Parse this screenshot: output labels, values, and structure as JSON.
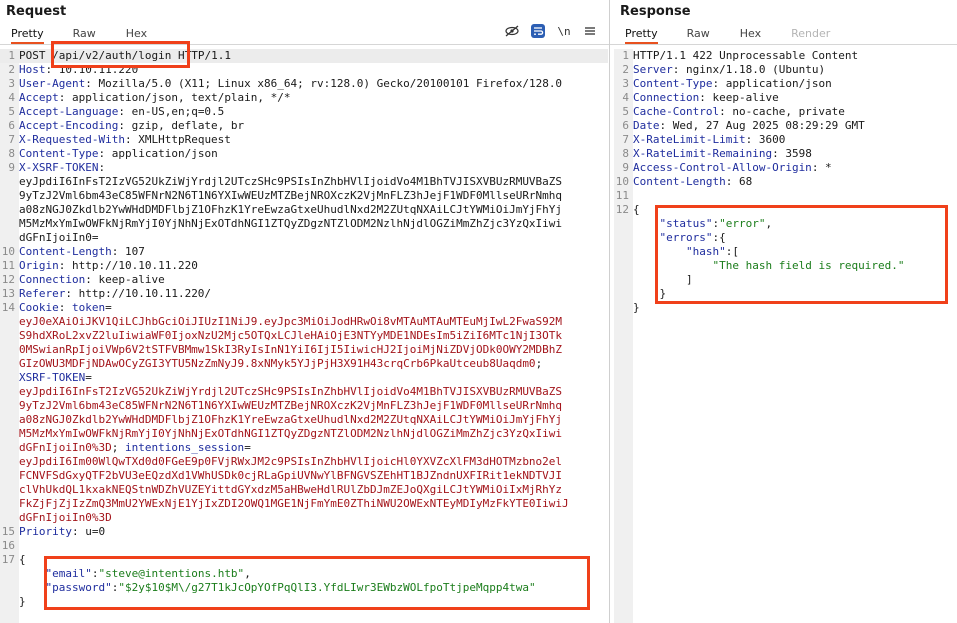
{
  "request": {
    "title": "Request",
    "tabs": [
      "Pretty",
      "Raw",
      "Hex"
    ],
    "newline_toggle": "\\n",
    "lines": [
      {
        "n": "1",
        "parts": [
          [
            "POST ",
            "lt"
          ],
          [
            "/api/v2/auth/login",
            "lt"
          ],
          [
            " HTTP/1.1",
            "lt"
          ]
        ]
      },
      {
        "n": "2",
        "parts": [
          [
            "Host",
            "k"
          ],
          [
            ": 10.10.11.220",
            "v"
          ]
        ]
      },
      {
        "n": "3",
        "parts": [
          [
            "User-Agent",
            "k"
          ],
          [
            ": Mozilla/5.0 (X11; Linux x86_64; rv:128.0) Gecko/20100101 Firefox/128.0",
            "v"
          ]
        ]
      },
      {
        "n": "4",
        "parts": [
          [
            "Accept",
            "k"
          ],
          [
            ": application/json, text/plain, */*",
            "v"
          ]
        ]
      },
      {
        "n": "5",
        "parts": [
          [
            "Accept-Language",
            "k"
          ],
          [
            ": en-US,en;q=0.5",
            "v"
          ]
        ]
      },
      {
        "n": "6",
        "parts": [
          [
            "Accept-Encoding",
            "k"
          ],
          [
            ": gzip, deflate, br",
            "v"
          ]
        ]
      },
      {
        "n": "7",
        "parts": [
          [
            "X-Requested-With",
            "k"
          ],
          [
            ": XMLHttpRequest",
            "v"
          ]
        ]
      },
      {
        "n": "8",
        "parts": [
          [
            "Content-Type",
            "k"
          ],
          [
            ": application/json",
            "v"
          ]
        ]
      },
      {
        "n": "9",
        "parts": [
          [
            "X-XSRF-TOKEN",
            "k"
          ],
          [
            ":",
            "v"
          ]
        ]
      },
      {
        "n": "",
        "parts": [
          [
            "eyJpdiI6InFsT2IzVG52UkZiWjYrdjl2UTczSHc9PSIsInZhbHVlIjoidVo4M1BhTVJISXVBUzRMUVBaZS",
            "v"
          ]
        ]
      },
      {
        "n": "",
        "parts": [
          [
            "9yTzJ2Vml6bm43eC85WFNrN2N6T1N6YXIwWEUzMTZBejNROXczK2VjMnFLZ3hJejF1WDF0MllseURrNmhq",
            "v"
          ]
        ]
      },
      {
        "n": "",
        "parts": [
          [
            "a08zNGJ0Zkdlb2YwWHdDMDFlbjZ1OFhzK1YreEwzaGtxeUhudlNxd2M2ZUtqNXAiLCJtYWMiOiJmYjFhYj",
            "v"
          ]
        ]
      },
      {
        "n": "",
        "parts": [
          [
            "M5MzMxYmIwOWFkNjRmYjI0YjNhNjExOTdhNGI1ZTQyZDgzNTZlODM2NzlhNjdlOGZiMmZhZjc3YzQxIiwi",
            "v"
          ]
        ]
      },
      {
        "n": "",
        "parts": [
          [
            "dGFnIjoiIn0=",
            "v"
          ]
        ]
      },
      {
        "n": "10",
        "parts": [
          [
            "Content-Length",
            "k"
          ],
          [
            ": 107",
            "v"
          ]
        ]
      },
      {
        "n": "11",
        "parts": [
          [
            "Origin",
            "k"
          ],
          [
            ": http://10.10.11.220",
            "v"
          ]
        ]
      },
      {
        "n": "12",
        "parts": [
          [
            "Connection",
            "k"
          ],
          [
            ": keep-alive",
            "v"
          ]
        ]
      },
      {
        "n": "13",
        "parts": [
          [
            "Referer",
            "k"
          ],
          [
            ": http://10.10.11.220/",
            "v"
          ]
        ]
      },
      {
        "n": "14",
        "parts": [
          [
            "Cookie",
            "k"
          ],
          [
            ": ",
            "v"
          ],
          [
            "token",
            "k"
          ],
          [
            "=",
            "v"
          ]
        ]
      },
      {
        "n": "",
        "parts": [
          [
            "eyJ0eXAiOiJKV1QiLCJhbGciOiJIUzI1NiJ9.eyJpc3MiOiJodHRwOi8vMTAuMTAuMTEuMjIwL2FwaS92M",
            "red"
          ]
        ]
      },
      {
        "n": "",
        "parts": [
          [
            "S9hdXRoL2xvZ2luIiwiaWF0IjoxNzU2Mjc5OTQxLCJleHAiOjE3NTYyMDE1NDEsIm5iZiI6MTc1NjI3OTk",
            "red"
          ]
        ]
      },
      {
        "n": "",
        "parts": [
          [
            "0MSwianRpIjoiVWp6V2tSTFVBMmw1SkI3RyIsInN1YiI6IjI5IiwicHJ2IjoiMjNiZDVjODk0OWY2MDBhZ",
            "red"
          ]
        ]
      },
      {
        "n": "",
        "parts": [
          [
            "GIzOWU3MDFjNDAwOCyZGI3YTU5NzZmNyJ9.8xNMyk5YJjPjH3X91H43crqCrb6PkaUtceub8Uaqdm0",
            "red"
          ],
          [
            ";",
            "v"
          ]
        ]
      },
      {
        "n": "",
        "parts": [
          [
            "XSRF-TOKEN",
            "k"
          ],
          [
            "=",
            "v"
          ]
        ]
      },
      {
        "n": "",
        "parts": [
          [
            "eyJpdiI6InFsT2IzVG52UkZiWjYrdjl2UTczSHc9PSIsInZhbHVlIjoidVo4M1BhTVJISXVBUzRMUVBaZS",
            "red"
          ]
        ]
      },
      {
        "n": "",
        "parts": [
          [
            "9yTzJ2Vml6bm43eC85WFNrN2N6T1N6YXIwWEUzMTZBejNROXczK2VjMnFLZ3hJejF1WDF0MllseURrNmhq",
            "red"
          ]
        ]
      },
      {
        "n": "",
        "parts": [
          [
            "a08zNGJ0Zkdlb2YwWHdDMDFlbjZ1OFhzK1YreEwzaGtxeUhudlNxd2M2ZUtqNXAiLCJtYWMiOiJmYjFhYj",
            "red"
          ]
        ]
      },
      {
        "n": "",
        "parts": [
          [
            "M5MzMxYmIwOWFkNjRmYjI0YjNhNjExOTdhNGI1ZTQyZDgzNTZlODM2NzlhNjdlOGZiMmZhZjc3YzQxIiwi",
            "red"
          ]
        ]
      },
      {
        "n": "",
        "parts": [
          [
            "dGFnIjoiIn0%3D",
            "red"
          ],
          [
            "; ",
            "v"
          ],
          [
            "intentions_session",
            "k"
          ],
          [
            "=",
            "v"
          ]
        ]
      },
      {
        "n": "",
        "parts": [
          [
            "eyJpdiI6Im00WlQwTXd0d0FGeE9p0FVjRWxJM2c9PSIsInZhbHVlIjoicHl0YXVZcXlFM3dHOTMzbno2el",
            "red"
          ]
        ]
      },
      {
        "n": "",
        "parts": [
          [
            "FCNVFSdGxyQTF2bVU3eEQzdXd1VWhUSDk0cjRLaGpiUVNwYlBFNGVSZEhHT1BJZndnUXFIRit1ekNDTVJI",
            "red"
          ]
        ]
      },
      {
        "n": "",
        "parts": [
          [
            "clVhUkdQL1kxakNEQStnWDZhVUZEYittdGYxdzM5aHBweHdlRUlZbDJmZEJoQXgiLCJtYWMiOiIxMjRhYz",
            "red"
          ]
        ]
      },
      {
        "n": "",
        "parts": [
          [
            "FkZjFjZjIzZmQ3MmU2YWExNjE1YjIxZDI2OWQ1MGE1NjFmYmE0ZThiNWU2OWExNTEyMDIyMzFkYTE0IiwiJ",
            "red"
          ]
        ]
      },
      {
        "n": "",
        "parts": [
          [
            "dGFnIjoiIn0%3D",
            "red"
          ]
        ]
      },
      {
        "n": "15",
        "parts": [
          [
            "Priority",
            "k"
          ],
          [
            ": u=0",
            "v"
          ]
        ]
      },
      {
        "n": "16",
        "parts": [
          [
            "",
            "v"
          ]
        ]
      },
      {
        "n": "17",
        "parts": [
          [
            "{",
            "v"
          ]
        ]
      },
      {
        "n": "",
        "parts": [
          [
            "    ",
            "v"
          ],
          [
            "\"email\"",
            "jk"
          ],
          [
            ":",
            "v"
          ],
          [
            "\"steve@intentions.htb\"",
            "js"
          ],
          [
            ",",
            "v"
          ]
        ]
      },
      {
        "n": "",
        "parts": [
          [
            "    ",
            "v"
          ],
          [
            "\"password\"",
            "jk"
          ],
          [
            ":",
            "v"
          ],
          [
            "\"$2y$10$M\\/g27T1kJcOpYOfPqQlI3.YfdLIwr3EWbzWOLfpoTtjpeMqpp4twa\"",
            "js"
          ]
        ]
      },
      {
        "n": "",
        "parts": [
          [
            "}",
            "v"
          ]
        ]
      }
    ]
  },
  "response": {
    "title": "Response",
    "tabs": [
      "Pretty",
      "Raw",
      "Hex",
      "Render"
    ],
    "lines": [
      {
        "n": "1",
        "parts": [
          [
            "HTTP/1.1 422 Unprocessable Content",
            "v"
          ]
        ]
      },
      {
        "n": "2",
        "parts": [
          [
            "Server",
            "k"
          ],
          [
            ": nginx/1.18.0 (Ubuntu)",
            "v"
          ]
        ]
      },
      {
        "n": "3",
        "parts": [
          [
            "Content-Type",
            "k"
          ],
          [
            ": application/json",
            "v"
          ]
        ]
      },
      {
        "n": "4",
        "parts": [
          [
            "Connection",
            "k"
          ],
          [
            ": keep-alive",
            "v"
          ]
        ]
      },
      {
        "n": "5",
        "parts": [
          [
            "Cache-Control",
            "k"
          ],
          [
            ": no-cache, private",
            "v"
          ]
        ]
      },
      {
        "n": "6",
        "parts": [
          [
            "Date",
            "k"
          ],
          [
            ": Wed, 27 Aug 2025 08:29:29 GMT",
            "v"
          ]
        ]
      },
      {
        "n": "7",
        "parts": [
          [
            "X-RateLimit-Limit",
            "k"
          ],
          [
            ": 3600",
            "v"
          ]
        ]
      },
      {
        "n": "8",
        "parts": [
          [
            "X-RateLimit-Remaining",
            "k"
          ],
          [
            ": 3598",
            "v"
          ]
        ]
      },
      {
        "n": "9",
        "parts": [
          [
            "Access-Control-Allow-Origin",
            "k"
          ],
          [
            ": *",
            "v"
          ]
        ]
      },
      {
        "n": "10",
        "parts": [
          [
            "Content-Length",
            "k"
          ],
          [
            ": 68",
            "v"
          ]
        ]
      },
      {
        "n": "11",
        "parts": [
          [
            "",
            "v"
          ]
        ]
      },
      {
        "n": "12",
        "parts": [
          [
            "{",
            "v"
          ]
        ]
      },
      {
        "n": "",
        "parts": [
          [
            "    ",
            "v"
          ],
          [
            "\"status\"",
            "jk"
          ],
          [
            ":",
            "v"
          ],
          [
            "\"error\"",
            "js"
          ],
          [
            ",",
            "v"
          ]
        ]
      },
      {
        "n": "",
        "parts": [
          [
            "    ",
            "v"
          ],
          [
            "\"errors\"",
            "jk"
          ],
          [
            ":{",
            "v"
          ]
        ]
      },
      {
        "n": "",
        "parts": [
          [
            "        ",
            "v"
          ],
          [
            "\"hash\"",
            "jk"
          ],
          [
            ":[",
            "v"
          ]
        ]
      },
      {
        "n": "",
        "parts": [
          [
            "            ",
            "v"
          ],
          [
            "\"The hash field is required.\"",
            "js"
          ]
        ]
      },
      {
        "n": "",
        "parts": [
          [
            "        ]",
            "v"
          ]
        ]
      },
      {
        "n": "",
        "parts": [
          [
            "    }",
            "v"
          ]
        ]
      },
      {
        "n": "",
        "parts": [
          [
            "}",
            "v"
          ]
        ]
      }
    ]
  }
}
